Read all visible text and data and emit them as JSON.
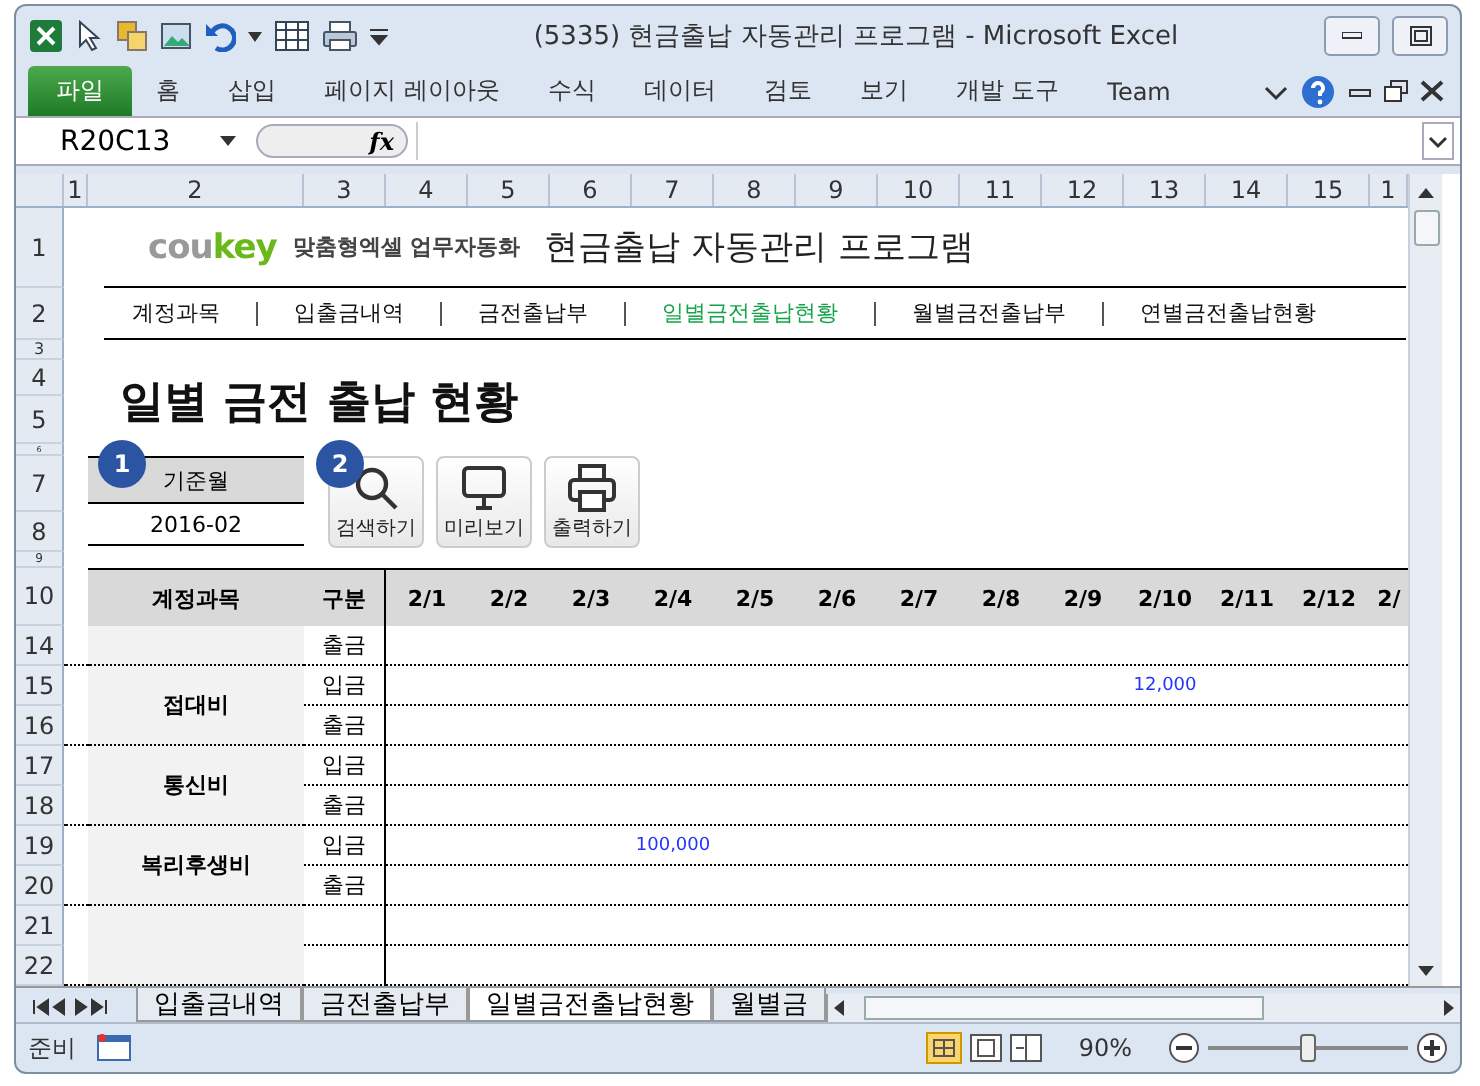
{
  "window": {
    "title": "(5335) 현금출납 자동관리 프로그램  -  Microsoft Excel"
  },
  "ribbon": {
    "tabs": [
      {
        "label": "파일",
        "kind": "file"
      },
      {
        "label": "홈",
        "kind": "tab"
      },
      {
        "label": "삽입",
        "kind": "tab"
      },
      {
        "label": "페이지 레이아웃",
        "kind": "tab"
      },
      {
        "label": "수식",
        "kind": "tab"
      },
      {
        "label": "데이터",
        "kind": "tab"
      },
      {
        "label": "검토",
        "kind": "tab"
      },
      {
        "label": "보기",
        "kind": "tab"
      },
      {
        "label": "개발 도구",
        "kind": "tab"
      },
      {
        "label": "Team",
        "kind": "tab"
      }
    ]
  },
  "formula_bar": {
    "name_box": "R20C13",
    "fx": "fx"
  },
  "column_headers": [
    "1",
    "2",
    "3",
    "4",
    "5",
    "6",
    "7",
    "8",
    "9",
    "10",
    "11",
    "12",
    "13",
    "14",
    "15",
    "1"
  ],
  "header": {
    "logo": [
      "cou",
      "key"
    ],
    "tagline": "맞춤형엑셀 업무자동화",
    "title": "현금출납 자동관리 프로그램"
  },
  "nav": [
    {
      "label": "계정과목",
      "selected": false
    },
    {
      "label": "입출금내역",
      "selected": false
    },
    {
      "label": "금전출납부",
      "selected": false
    },
    {
      "label": "일별금전출납현황",
      "selected": true
    },
    {
      "label": "월별금전출납부",
      "selected": false
    },
    {
      "label": "연별금전출납현황",
      "selected": false
    }
  ],
  "heading": "일별 금전 출납 현황",
  "badges": [
    "1",
    "2"
  ],
  "base_month": {
    "label": "기준월",
    "value": "2016-02"
  },
  "actions": [
    {
      "label": "검색하기",
      "kind": "search"
    },
    {
      "label": "미리보기",
      "kind": "monitor"
    },
    {
      "label": "출력하기",
      "kind": "printer"
    }
  ],
  "top_row_headers": [
    "1",
    "2",
    "3",
    "4",
    "5",
    "6",
    "7",
    "8",
    "9"
  ],
  "table": {
    "row_header": "10",
    "columns": [
      "계정과목",
      "구분",
      "2/1",
      "2/2",
      "2/3",
      "2/4",
      "2/5",
      "2/6",
      "2/7",
      "2/8",
      "2/9",
      "2/10",
      "2/11",
      "2/12",
      "2/"
    ],
    "groups": [
      {
        "entries": [
          {
            "row": "14",
            "type": "출금"
          }
        ]
      },
      {
        "account": "접대비",
        "entries": [
          {
            "row": "15",
            "type": "입금",
            "days": [
              {
                "kind": "blank"
              },
              {
                "kind": "blank"
              },
              {
                "kind": "blank"
              },
              {
                "kind": "blank"
              },
              {
                "kind": "blank"
              },
              {
                "kind": "blank"
              },
              {
                "kind": "blank"
              },
              {
                "kind": "blank"
              },
              {
                "kind": "blank"
              },
              {
                "kind": "amount",
                "text": "12,000"
              }
            ]
          },
          {
            "row": "16",
            "type": "출금"
          }
        ]
      },
      {
        "account": "통신비",
        "entries": [
          {
            "row": "17",
            "type": "입금"
          },
          {
            "row": "18",
            "type": "출금"
          }
        ]
      },
      {
        "account": "복리후생비",
        "entries": [
          {
            "row": "19",
            "type": "입금",
            "days": [
              {
                "kind": "blank"
              },
              {
                "kind": "blank"
              },
              {
                "kind": "blank"
              },
              {
                "kind": "amount",
                "text": "100,000"
              }
            ]
          },
          {
            "row": "20",
            "type": "출금"
          }
        ]
      },
      {
        "entries": [
          {
            "row": "21"
          },
          {
            "row": "22"
          }
        ]
      }
    ]
  },
  "sheet_tabs": [
    {
      "label": "입출금내역",
      "selected": false
    },
    {
      "label": "금전출납부",
      "selected": false
    },
    {
      "label": "일별금전출납현황",
      "selected": true
    },
    {
      "label": "월별금",
      "selected": false
    }
  ],
  "status_bar": {
    "status": "준비",
    "zoom": "90%",
    "zoom_slider": {
      "level": 0.5
    }
  }
}
